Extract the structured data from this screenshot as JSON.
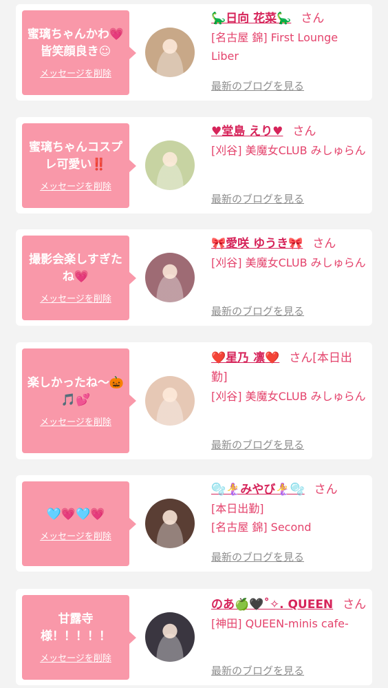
{
  "cards": [
    {
      "message": "蜜璃ちゃんかわ💗皆笑顔良き☺",
      "delete_label": "メッセージを削除",
      "name": "🦕日向 花菜🦕",
      "honorific": "さん",
      "status": "",
      "shop_area": "[名古屋 錦]",
      "shop_name": "First Lounge Liber",
      "blog_label": "最新のブログを見る",
      "avatar_bg": "#c8a888"
    },
    {
      "message": "蜜璃ちゃんコスプレ可愛い‼️",
      "delete_label": "メッセージを削除",
      "name": "♥堂島 えり♥",
      "honorific": "さん",
      "status": "",
      "shop_area": "[刈谷]",
      "shop_name": "美魔女CLUB みしゅらん",
      "blog_label": "最新のブログを見る",
      "avatar_bg": "#c7d3a2"
    },
    {
      "message": "撮影会楽しすぎたね💗",
      "delete_label": "メッセージを削除",
      "name": "🎀愛咲 ゆうき🎀",
      "honorific": "さん",
      "status": "",
      "shop_area": "[刈谷]",
      "shop_name": "美魔女CLUB みしゅらん",
      "blog_label": "最新のブログを見る",
      "avatar_bg": "#9e6b74"
    },
    {
      "message": "楽しかったね〜🎃🎵💕",
      "delete_label": "メッセージを削除",
      "name": "❤️星乃 凛❤️",
      "honorific": "さん",
      "status": "[本日出勤]",
      "shop_area": "[刈谷]",
      "shop_name": "美魔女CLUB みしゅらん",
      "blog_label": "最新のブログを見る",
      "avatar_bg": "#e6c8b5"
    },
    {
      "message": "🩵💗🩵💗",
      "delete_label": "メッセージを削除",
      "name": "🫧🧜‍♀️みやび🧜‍♀️🫧",
      "honorific": "さん",
      "status": "[本日出勤]",
      "shop_area": "[名古屋 錦]",
      "shop_name": "Second",
      "blog_label": "最新のブログを見る",
      "avatar_bg": "#5a3e34"
    },
    {
      "message": "甘露寺様！！！！！",
      "delete_label": "メッセージを削除",
      "name": "のあ🍏🖤˚✧. QUEEN",
      "honorific": "さん",
      "status": "",
      "shop_area": "[神田]",
      "shop_name": "QUEEN-minis cafe-",
      "blog_label": "最新のブログを見る",
      "avatar_bg": "#3a3640"
    }
  ]
}
